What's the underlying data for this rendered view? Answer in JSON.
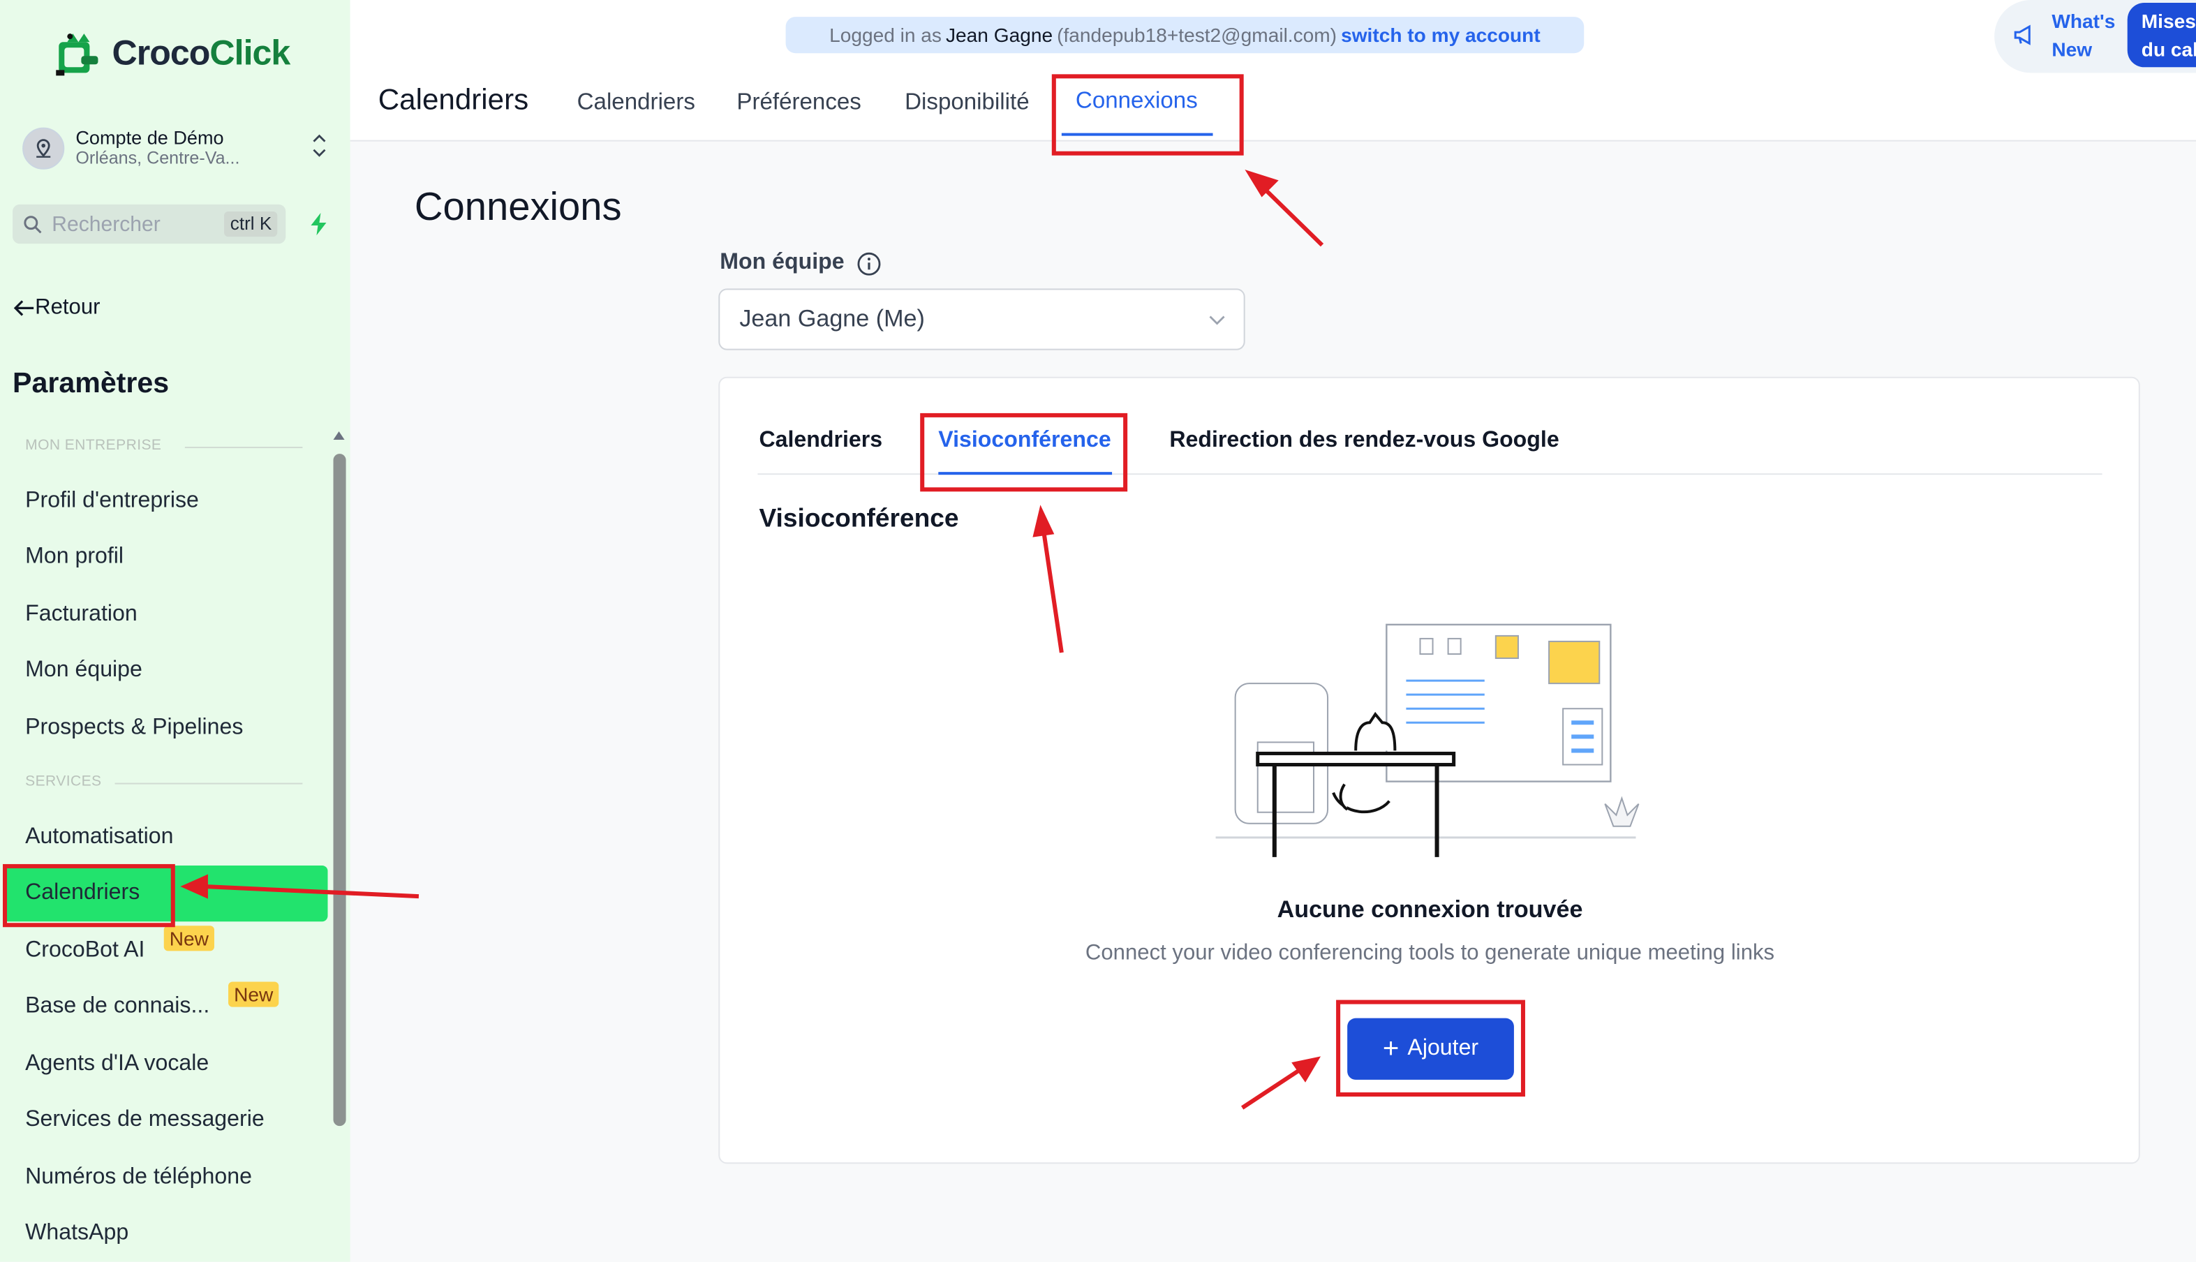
{
  "brand": {
    "name_part1": "Croco",
    "name_part2": "Click"
  },
  "account": {
    "name": "Compte de Démo",
    "location": "Orléans, Centre-Va..."
  },
  "search": {
    "placeholder": "Rechercher",
    "shortcut": "ctrl K"
  },
  "sidebar": {
    "back_label": "Retour",
    "settings_title": "Paramètres",
    "section_company": "MON ENTREPRISE",
    "section_services": "SERVICES",
    "company_items": [
      {
        "label": "Profil d'entreprise"
      },
      {
        "label": "Mon profil"
      },
      {
        "label": "Facturation"
      },
      {
        "label": "Mon équipe"
      },
      {
        "label": "Prospects & Pipelines"
      }
    ],
    "service_items": [
      {
        "label": "Automatisation"
      },
      {
        "label": "Calendriers",
        "active": true
      },
      {
        "label": "CrocoBot AI",
        "badge": "New"
      },
      {
        "label": "Base de connais...",
        "badge": "New"
      },
      {
        "label": "Agents d'IA vocale"
      },
      {
        "label": "Services de messagerie"
      },
      {
        "label": "Numéros de téléphone"
      },
      {
        "label": "WhatsApp"
      }
    ]
  },
  "banner": {
    "prefix": "Logged in as",
    "user_name": "Jean Gagne",
    "user_email": "(fandepub18+test2@gmail.com)",
    "switch_link": "switch to my account"
  },
  "header": {
    "page_title": "Calendriers",
    "tabs": [
      {
        "label": "Calendriers"
      },
      {
        "label": "Préférences"
      },
      {
        "label": "Disponibilité"
      },
      {
        "label": "Connexions",
        "active": true
      }
    ],
    "whats_new_line1": "What's",
    "whats_new_line2": "New",
    "mises_line1": "Mises",
    "mises_line2": "du cal"
  },
  "main": {
    "title": "Connexions",
    "team_label": "Mon équipe",
    "team_value": "Jean Gagne (Me)",
    "card_tabs": [
      {
        "label": "Calendriers"
      },
      {
        "label": "Visioconférence",
        "active": true
      },
      {
        "label": "Redirection des rendez-vous Google"
      }
    ],
    "section_title": "Visioconférence",
    "empty_title": "Aucune connexion trouvée",
    "empty_desc": "Connect your video conferencing tools to generate unique meeting links",
    "add_button": "Ajouter"
  },
  "colors": {
    "sidebar_bg": "#e8fbea",
    "active_green": "#22e36d",
    "accent_blue": "#2563eb",
    "button_blue": "#1d4ed8",
    "annotation_red": "#e11d24",
    "badge_yellow": "#fcd34d"
  }
}
